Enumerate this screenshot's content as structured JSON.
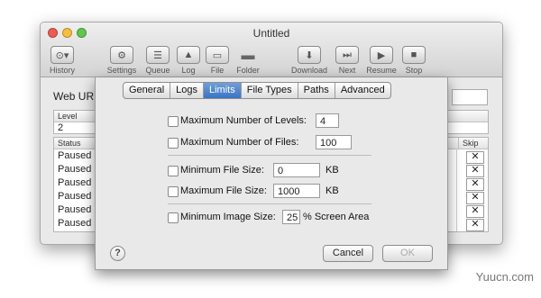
{
  "window": {
    "title": "Untitled"
  },
  "toolbar": {
    "items": [
      {
        "label": "History",
        "icon": "history-icon",
        "glyph": "⊙▾"
      },
      {
        "label": "Settings",
        "icon": "gear-icon",
        "glyph": "⚙"
      },
      {
        "label": "Queue",
        "icon": "list-icon",
        "glyph": "☰"
      },
      {
        "label": "Log",
        "icon": "warning-icon",
        "glyph": "▲"
      },
      {
        "label": "File",
        "icon": "file-icon",
        "glyph": "▭"
      },
      {
        "label": "Folder",
        "icon": "folder-icon",
        "glyph": "▬"
      },
      {
        "label": "Download",
        "icon": "download-icon",
        "glyph": "⬇"
      },
      {
        "label": "Next",
        "icon": "next-icon",
        "glyph": "⏭"
      },
      {
        "label": "Resume",
        "icon": "play-icon",
        "glyph": "▶"
      },
      {
        "label": "Stop",
        "icon": "stop-icon",
        "glyph": "■"
      }
    ]
  },
  "main": {
    "web_url_label": "Web URL:",
    "level_table": {
      "header": "Level",
      "value": "2"
    },
    "status_table": {
      "status_header": "Status",
      "skip_header": "Skip",
      "rows": [
        "Paused",
        "Paused",
        "Paused",
        "Paused",
        "Paused",
        "Paused"
      ],
      "skip_glyph": "✕"
    }
  },
  "sheet": {
    "tabs": [
      "General",
      "Logs",
      "Limits",
      "File Types",
      "Paths",
      "Advanced"
    ],
    "selected_tab": "Limits",
    "limits": {
      "max_levels": {
        "label": "Maximum Number of Levels:",
        "value": "4",
        "checked": false
      },
      "max_files": {
        "label": "Maximum Number of Files:",
        "value": "100",
        "checked": false
      },
      "min_file_size": {
        "label": "Minimum File Size:",
        "value": "0",
        "unit": "KB",
        "checked": false
      },
      "max_file_size": {
        "label": "Maximum File Size:",
        "value": "1000",
        "unit": "KB",
        "checked": false
      },
      "min_image_size": {
        "label": "Minimum Image Size:",
        "value": "25",
        "unit": "% Screen Area",
        "checked": false
      }
    },
    "help_glyph": "?",
    "cancel_label": "Cancel",
    "ok_label": "OK"
  },
  "watermark": "Yuucn.com",
  "colors": {
    "selected_tab": "#3a73c6",
    "close": "#ee5b52",
    "minimize": "#f6be3b",
    "zoom": "#5fc84b"
  }
}
